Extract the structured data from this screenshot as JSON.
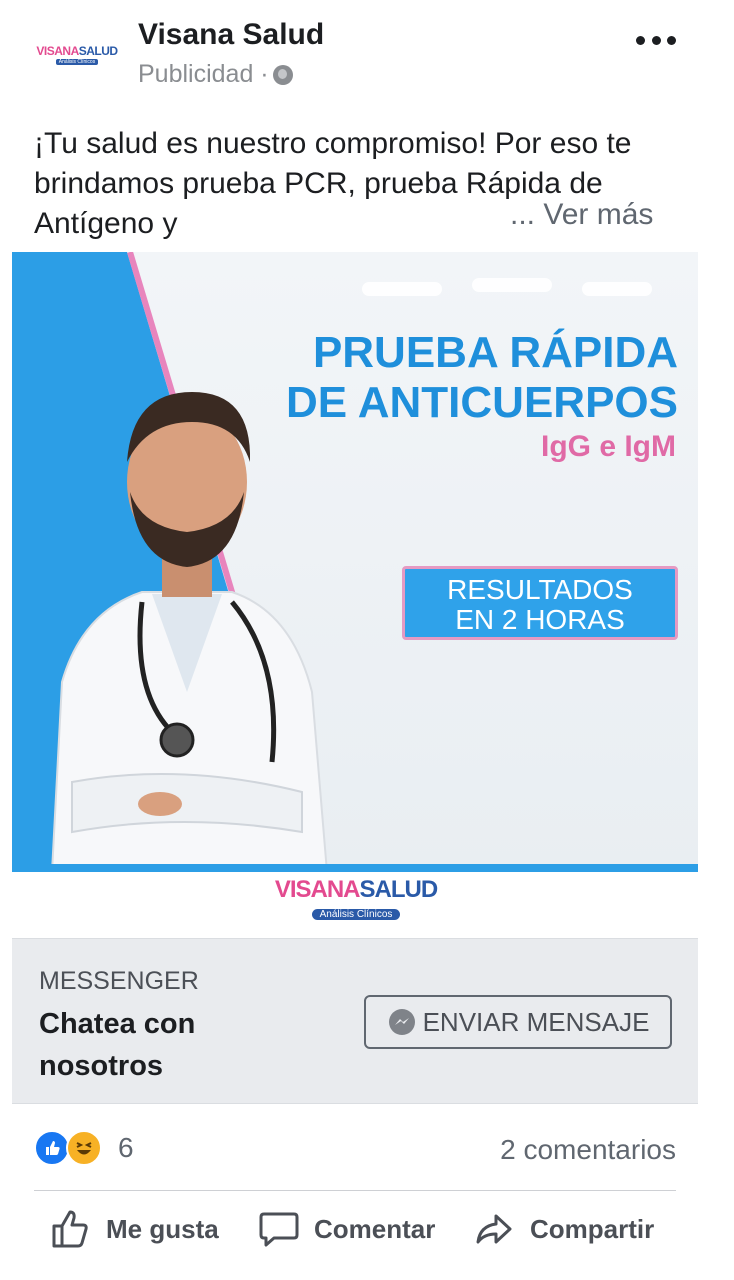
{
  "post": {
    "page_name": "Visana Salud",
    "sponsored_label": "Publicidad ·",
    "text": "¡Tu salud es nuestro compromiso! Por eso te brindamos prueba PCR, prueba Rápida de Antígeno y",
    "see_more": "... Ver más"
  },
  "avatar_logo": {
    "word1": "VISANA",
    "word2": "SALUD",
    "sub": "Análisis Clínicos"
  },
  "ad": {
    "headline_line1": "PRUEBA RÁPIDA",
    "headline_line2": "DE ANTICUERPOS",
    "sub": "IgG e IgM",
    "result_line1": "RESULTADOS",
    "result_line2": "EN 2 HORAS",
    "logo_word1": "VISANA",
    "logo_word2": "SALUD",
    "logo_sub": "Análisis Clínicos",
    "colors": {
      "blue": "#2c9ee6",
      "pink": "#e06aa6"
    }
  },
  "cta": {
    "channel": "MESSENGER",
    "headline": "Chatea con nosotros",
    "button_label": "ENVIAR MENSAJE"
  },
  "engagement": {
    "reaction_count": "6",
    "comments": "2 comentarios",
    "reactions": [
      "like-icon",
      "haha-icon"
    ]
  },
  "actions": {
    "like": "Me gusta",
    "comment": "Comentar",
    "share": "Compartir"
  }
}
